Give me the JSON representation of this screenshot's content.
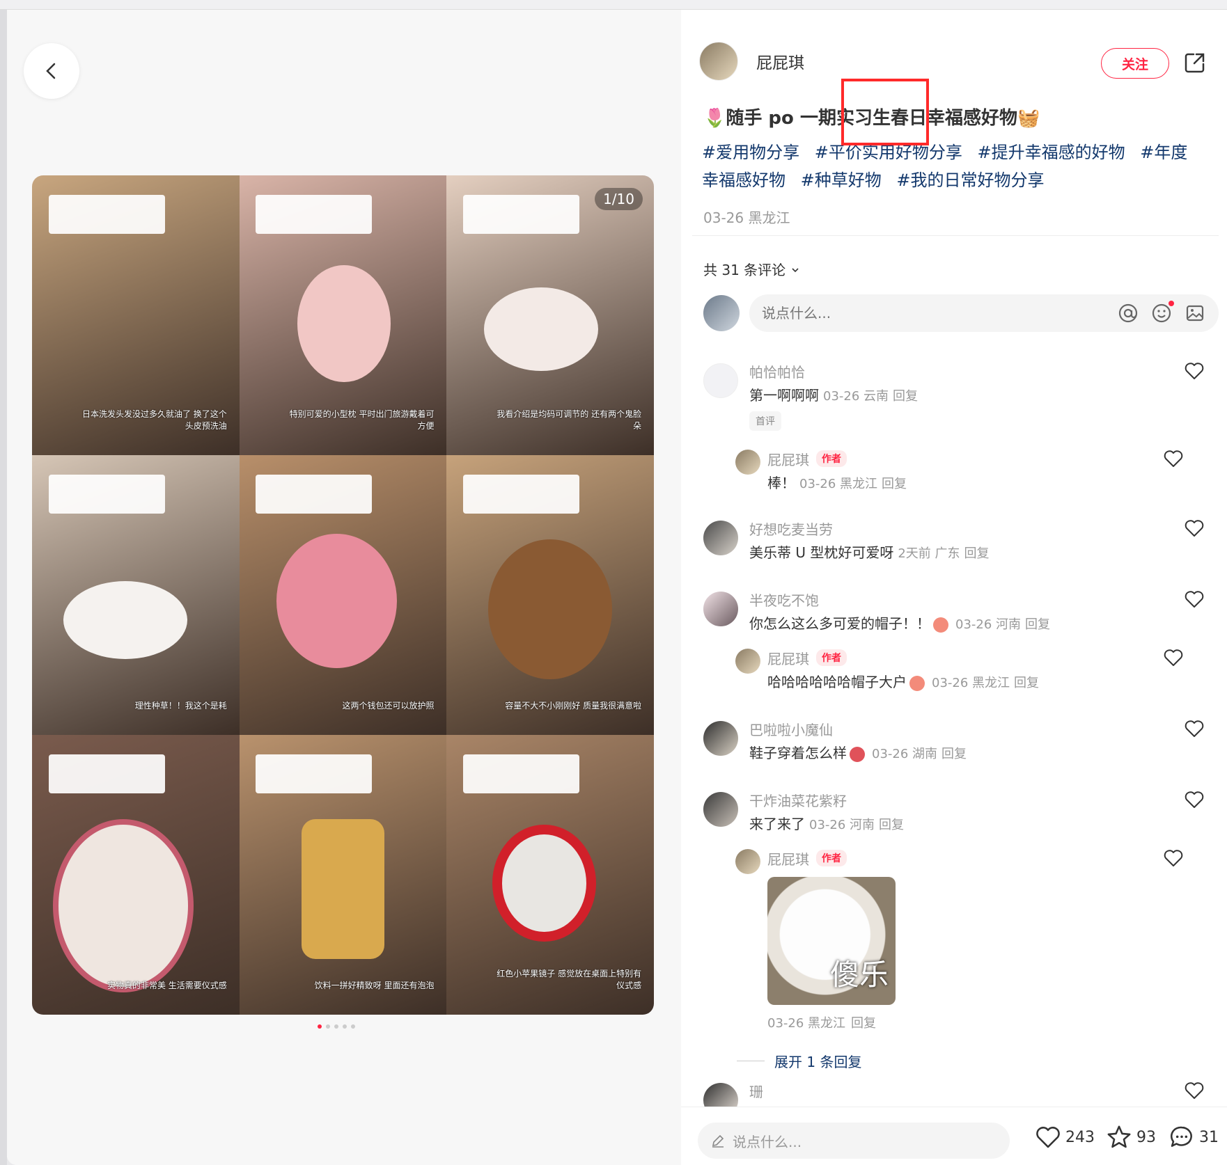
{
  "post": {
    "author_name": "屁屁琪",
    "follow_label": "关注",
    "title": "🌷随手 po 一期实习生春日幸福感好物🧺",
    "tags": [
      "#爱用物分享",
      "#平价实用好物分享",
      "#提升幸福感的好物",
      "#年度幸福感好物",
      "#种草好物",
      "#我的日常好物分享"
    ],
    "date_location": "03-26 黑龙江",
    "image_counter": "1/10",
    "tile_notes": [
      "日本洗发头发没过多久就油了 换了这个头皮预洗油",
      "特别可爱的小型枕 平时出门旅游戴着可方便",
      "我看介绍是均码可调节的 还有两个鬼脸朵",
      "理性种草！！我这个是耗",
      "这两个钱包还可以放护照",
      "容量不大不小刚刚好 质量我很满意啦",
      "实物真的非常美 生活需要仪式感",
      "饮料一拼好精致呀 里面还有泡泡",
      "红色小苹果镜子 感觉放在桌面上特别有仪式感"
    ],
    "tile_colors": [
      "#c8a67f",
      "#d9b4a8",
      "#e4cfc0",
      "#d6c6b6",
      "#b88f6a",
      "#c6a27b",
      "#7a5b4d",
      "#b9926d",
      "#a98567"
    ]
  },
  "comments": {
    "count_label": "共 31 条评论",
    "input_placeholder": "说点什么...",
    "items": [
      {
        "name": "帕恰帕恰",
        "text": "第一啊啊啊",
        "date": "03-26 云南",
        "reply": "回复",
        "badge": "首评"
      },
      {
        "name": "屁屁琪",
        "author_badge": "作者",
        "text": "棒！",
        "date": "03-26 黑龙江",
        "reply": "回复"
      },
      {
        "name": "好想吃麦当劳",
        "text": "美乐蒂 U 型枕好可爱呀",
        "date": "2天前 广东",
        "reply": "回复"
      },
      {
        "name": "半夜吃不饱",
        "text": "你怎么这么多可爱的帽子！！",
        "date": "03-26 河南",
        "reply": "回复"
      },
      {
        "name": "屁屁琪",
        "author_badge": "作者",
        "text": "哈哈哈哈哈哈帽子大户",
        "date": "03-26 黑龙江",
        "reply": "回复"
      },
      {
        "name": "巴啦啦小魔仙",
        "text": "鞋子穿着怎么样",
        "date": "03-26 湖南",
        "reply": "回复"
      },
      {
        "name": "干炸油菜花紫籽",
        "text": "来了来了",
        "date": "03-26 河南",
        "reply": "回复"
      },
      {
        "name": "屁屁琪",
        "author_badge": "作者",
        "image_caption": "傻乐",
        "date": "03-26 黑龙江",
        "reply": "回复"
      },
      {
        "name": "珊"
      }
    ],
    "expand_label": "展开 1 条回复"
  },
  "bottom": {
    "placeholder": "说点什么...",
    "likes": "243",
    "collects": "93",
    "comments": "31"
  },
  "colors": {
    "accent": "#ff2442",
    "tag": "#13386c"
  }
}
